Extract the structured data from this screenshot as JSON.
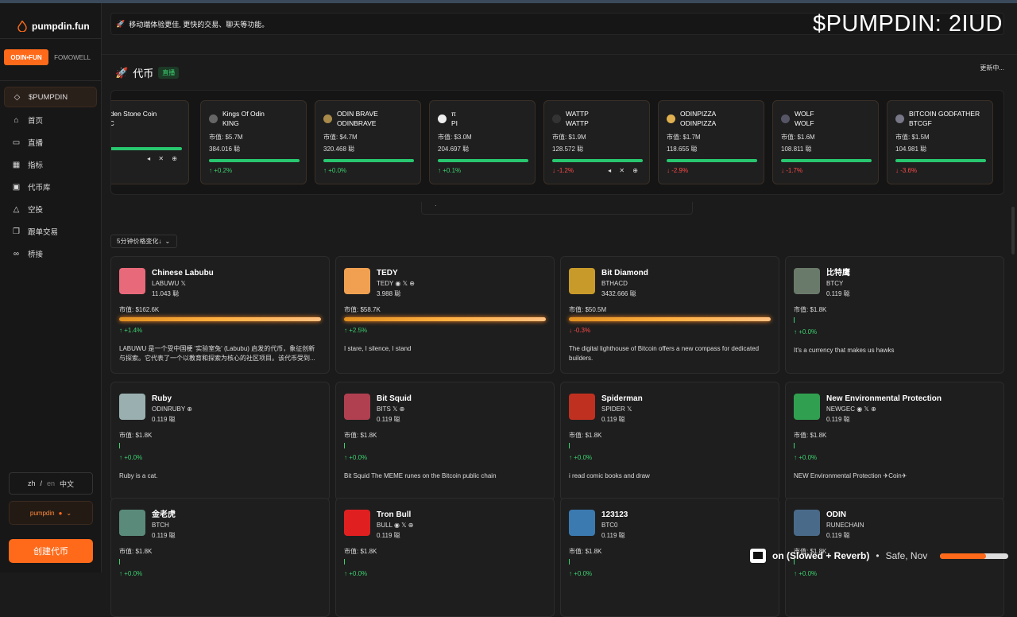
{
  "app": {
    "name": "pumpdin.fun"
  },
  "overlay_title": "$PUMPDIN: 2IUD",
  "sidebar": {
    "switch": [
      "ODIN•FUN",
      "FOMOWELL"
    ],
    "items": [
      {
        "label": "$PUMPDIN",
        "icon": "diamond-icon"
      },
      {
        "label": "首页",
        "icon": "home-icon"
      },
      {
        "label": "直播",
        "icon": "video-icon"
      },
      {
        "label": "指标",
        "icon": "chart-icon"
      },
      {
        "label": "代币库",
        "icon": "vault-icon"
      },
      {
        "label": "空投",
        "icon": "airdrop-icon"
      },
      {
        "label": "跟单交易",
        "icon": "copy-icon"
      },
      {
        "label": "桥接",
        "icon": "link-icon"
      }
    ],
    "lang": {
      "zh": "zh",
      "slash": "/",
      "en": "en",
      "current": "中文"
    },
    "user": "pumpdin",
    "create": "创建代币"
  },
  "banner": "移动端体验更佳, 更快的交易、聊天等功能。",
  "tokens_section": {
    "title": "代币",
    "live": "直播",
    "updating": "更新中..."
  },
  "ticker": [
    {
      "name": "olden Stone Coin",
      "ticker": "SC",
      "mcap": "3M",
      "holders": "",
      "change": "0%",
      "dir": "up",
      "socials": "◂ ✕ ⊕",
      "avatar": "#888"
    },
    {
      "name": "Kings Of Odin",
      "ticker": "KING",
      "mcap": "市值: $5.7M",
      "holders": "384.016 聪",
      "change": "↑ +0.2%",
      "dir": "up",
      "socials": "",
      "avatar": "#666"
    },
    {
      "name": "ODIN BRAVE",
      "ticker": "ODINBRAVE",
      "mcap": "市值: $4.7M",
      "holders": "320.468 聪",
      "change": "↑ +0.0%",
      "dir": "up",
      "socials": "",
      "avatar": "#a88a4a"
    },
    {
      "name": "π",
      "ticker": "PI",
      "mcap": "市值: $3.0M",
      "holders": "204.697 聪",
      "change": "↑ +0.1%",
      "dir": "up",
      "socials": "",
      "avatar": "#eee"
    },
    {
      "name": "WATTP",
      "ticker": "WATTP",
      "mcap": "市值: $1.9M",
      "holders": "128.572 聪",
      "change": "↓ -1.2%",
      "dir": "down",
      "socials": "◂ ✕ ⊕",
      "avatar": "#333"
    },
    {
      "name": "ODINPIZZA",
      "ticker": "ODINPIZZA",
      "mcap": "市值: $1.7M",
      "holders": "118.655 聪",
      "change": "↓ -2.9%",
      "dir": "down",
      "socials": "",
      "avatar": "#e0b050"
    },
    {
      "name": "WOLF",
      "ticker": "WOLF",
      "mcap": "市值: $1.6M",
      "holders": "108.811 聪",
      "change": "↓ -1.7%",
      "dir": "down",
      "socials": "",
      "avatar": "#556"
    },
    {
      "name": "BITCOIN GODFATHER",
      "ticker": "BTCGF",
      "mcap": "市值: $1.5M",
      "holders": "104.981 聪",
      "change": "↓ -3.6%",
      "dir": "down",
      "socials": "",
      "avatar": "#778"
    }
  ],
  "ticker_scroll": "·",
  "sort": {
    "label": "5分钟价格变化↓",
    "icon": "chevron-down-icon"
  },
  "cards": [
    {
      "name": "Chinese Labubu",
      "ticker": "LABUWU  𝕏",
      "holders": "11.043 聪",
      "mcap": "市值: $162.6K",
      "change": "↑ +1.4%",
      "dir": "up",
      "desc": "LABUWU 是一个受中国梗 '实验室兔' (Labubu) 启发的代币，象征创新与探索。它代表了一个以教育和探索为核心的社区项目。该代币受到...",
      "bar": "full",
      "color": "#e86a7a"
    },
    {
      "name": "TEDY",
      "ticker": "TEDY ◉ 𝕏 ⊕",
      "holders": "3.988 聪",
      "mcap": "市值: $58.7K",
      "change": "↑ +2.5%",
      "dir": "up",
      "desc": "I stare, I silence, I stand",
      "bar": "full",
      "color": "#f0a050"
    },
    {
      "name": "Bit Diamond",
      "ticker": "BTHACD",
      "holders": "3432.666 聪",
      "mcap": "市值: $50.5M",
      "change": "↓ -0.3%",
      "dir": "down",
      "desc": "The digital lighthouse of Bitcoin offers a new compass for dedicated builders.",
      "bar": "full",
      "color": "#c89a2a"
    },
    {
      "name": "比特鹰",
      "ticker": "BTCY",
      "holders": "0.119 聪",
      "mcap": "市值: $1.8K",
      "change": "↑ +0.0%",
      "dir": "up",
      "desc": "It's a currency that makes us hawks",
      "bar": "thin",
      "color": "#6a7a6a"
    },
    {
      "name": "Ruby",
      "ticker": "ODINRUBY ⊕",
      "holders": "0.119 聪",
      "mcap": "市值: $1.8K",
      "change": "↑ +0.0%",
      "dir": "up",
      "desc": "Ruby is a cat.",
      "bar": "thin",
      "color": "#9ab0b0"
    },
    {
      "name": "Bit Squid",
      "ticker": "BITS 𝕏 ⊕",
      "holders": "0.119 聪",
      "mcap": "市值: $1.8K",
      "change": "↑ +0.0%",
      "dir": "up",
      "desc": "Bit Squid The MEME runes on the Bitcoin public chain",
      "bar": "thin",
      "color": "#b04050"
    },
    {
      "name": "Spiderman",
      "ticker": "SPIDER 𝕏",
      "holders": "0.119 聪",
      "mcap": "市值: $1.8K",
      "change": "↑ +0.0%",
      "dir": "up",
      "desc": "i read comic books and draw",
      "bar": "thin",
      "color": "#c03020"
    },
    {
      "name": "New Environmental Protection",
      "ticker": "NEWGEC ◉ 𝕏 ⊕",
      "holders": "0.119 聪",
      "mcap": "市值: $1.8K",
      "change": "↑ +0.0%",
      "dir": "up",
      "desc": "NEW Environmental Protection ✈Coin✈",
      "bar": "thin",
      "color": "#30a050"
    },
    {
      "name": "金老虎",
      "ticker": "BTCH",
      "holders": "0.119 聪",
      "mcap": "市值: $1.8K",
      "change": "↑ +0.0%",
      "dir": "up",
      "desc": "",
      "bar": "thin",
      "color": "#5a8a7a"
    },
    {
      "name": "Tron Bull",
      "ticker": "BULL ◉ 𝕏 ⊕",
      "holders": "0.119 聪",
      "mcap": "市值: $1.8K",
      "change": "↑ +0.0%",
      "dir": "up",
      "desc": "",
      "bar": "thin",
      "color": "#e02020"
    },
    {
      "name": "123123",
      "ticker": "BTC0",
      "holders": "0.119 聪",
      "mcap": "市值: $1.8K",
      "change": "↑ +0.0%",
      "dir": "up",
      "desc": "",
      "bar": "thin",
      "color": "#3a7ab0"
    },
    {
      "name": "ODIN",
      "ticker": "RUNECHAIN",
      "holders": "0.119 聪",
      "mcap": "市值: $1.8K",
      "change": "↑ +0.0%",
      "dir": "up",
      "desc": "",
      "bar": "thin",
      "color": "#4a6a8a"
    }
  ],
  "player": {
    "title": "on (Slowed + Reverb)",
    "bullet": "•",
    "artist": "Safe, Nov",
    "progress": 0.67
  }
}
